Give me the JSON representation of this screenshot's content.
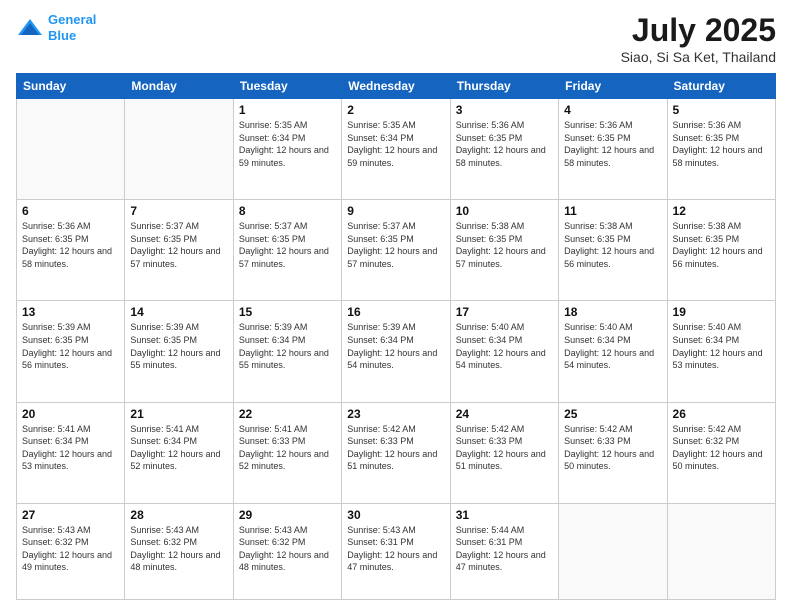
{
  "logo": {
    "line1": "General",
    "line2": "Blue"
  },
  "title": "July 2025",
  "subtitle": "Siao, Si Sa Ket, Thailand",
  "weekdays": [
    "Sunday",
    "Monday",
    "Tuesday",
    "Wednesday",
    "Thursday",
    "Friday",
    "Saturday"
  ],
  "weeks": [
    [
      {
        "day": "",
        "sunrise": "",
        "sunset": "",
        "daylight": ""
      },
      {
        "day": "",
        "sunrise": "",
        "sunset": "",
        "daylight": ""
      },
      {
        "day": "1",
        "sunrise": "Sunrise: 5:35 AM",
        "sunset": "Sunset: 6:34 PM",
        "daylight": "Daylight: 12 hours and 59 minutes."
      },
      {
        "day": "2",
        "sunrise": "Sunrise: 5:35 AM",
        "sunset": "Sunset: 6:34 PM",
        "daylight": "Daylight: 12 hours and 59 minutes."
      },
      {
        "day": "3",
        "sunrise": "Sunrise: 5:36 AM",
        "sunset": "Sunset: 6:35 PM",
        "daylight": "Daylight: 12 hours and 58 minutes."
      },
      {
        "day": "4",
        "sunrise": "Sunrise: 5:36 AM",
        "sunset": "Sunset: 6:35 PM",
        "daylight": "Daylight: 12 hours and 58 minutes."
      },
      {
        "day": "5",
        "sunrise": "Sunrise: 5:36 AM",
        "sunset": "Sunset: 6:35 PM",
        "daylight": "Daylight: 12 hours and 58 minutes."
      }
    ],
    [
      {
        "day": "6",
        "sunrise": "Sunrise: 5:36 AM",
        "sunset": "Sunset: 6:35 PM",
        "daylight": "Daylight: 12 hours and 58 minutes."
      },
      {
        "day": "7",
        "sunrise": "Sunrise: 5:37 AM",
        "sunset": "Sunset: 6:35 PM",
        "daylight": "Daylight: 12 hours and 57 minutes."
      },
      {
        "day": "8",
        "sunrise": "Sunrise: 5:37 AM",
        "sunset": "Sunset: 6:35 PM",
        "daylight": "Daylight: 12 hours and 57 minutes."
      },
      {
        "day": "9",
        "sunrise": "Sunrise: 5:37 AM",
        "sunset": "Sunset: 6:35 PM",
        "daylight": "Daylight: 12 hours and 57 minutes."
      },
      {
        "day": "10",
        "sunrise": "Sunrise: 5:38 AM",
        "sunset": "Sunset: 6:35 PM",
        "daylight": "Daylight: 12 hours and 57 minutes."
      },
      {
        "day": "11",
        "sunrise": "Sunrise: 5:38 AM",
        "sunset": "Sunset: 6:35 PM",
        "daylight": "Daylight: 12 hours and 56 minutes."
      },
      {
        "day": "12",
        "sunrise": "Sunrise: 5:38 AM",
        "sunset": "Sunset: 6:35 PM",
        "daylight": "Daylight: 12 hours and 56 minutes."
      }
    ],
    [
      {
        "day": "13",
        "sunrise": "Sunrise: 5:39 AM",
        "sunset": "Sunset: 6:35 PM",
        "daylight": "Daylight: 12 hours and 56 minutes."
      },
      {
        "day": "14",
        "sunrise": "Sunrise: 5:39 AM",
        "sunset": "Sunset: 6:35 PM",
        "daylight": "Daylight: 12 hours and 55 minutes."
      },
      {
        "day": "15",
        "sunrise": "Sunrise: 5:39 AM",
        "sunset": "Sunset: 6:34 PM",
        "daylight": "Daylight: 12 hours and 55 minutes."
      },
      {
        "day": "16",
        "sunrise": "Sunrise: 5:39 AM",
        "sunset": "Sunset: 6:34 PM",
        "daylight": "Daylight: 12 hours and 54 minutes."
      },
      {
        "day": "17",
        "sunrise": "Sunrise: 5:40 AM",
        "sunset": "Sunset: 6:34 PM",
        "daylight": "Daylight: 12 hours and 54 minutes."
      },
      {
        "day": "18",
        "sunrise": "Sunrise: 5:40 AM",
        "sunset": "Sunset: 6:34 PM",
        "daylight": "Daylight: 12 hours and 54 minutes."
      },
      {
        "day": "19",
        "sunrise": "Sunrise: 5:40 AM",
        "sunset": "Sunset: 6:34 PM",
        "daylight": "Daylight: 12 hours and 53 minutes."
      }
    ],
    [
      {
        "day": "20",
        "sunrise": "Sunrise: 5:41 AM",
        "sunset": "Sunset: 6:34 PM",
        "daylight": "Daylight: 12 hours and 53 minutes."
      },
      {
        "day": "21",
        "sunrise": "Sunrise: 5:41 AM",
        "sunset": "Sunset: 6:34 PM",
        "daylight": "Daylight: 12 hours and 52 minutes."
      },
      {
        "day": "22",
        "sunrise": "Sunrise: 5:41 AM",
        "sunset": "Sunset: 6:33 PM",
        "daylight": "Daylight: 12 hours and 52 minutes."
      },
      {
        "day": "23",
        "sunrise": "Sunrise: 5:42 AM",
        "sunset": "Sunset: 6:33 PM",
        "daylight": "Daylight: 12 hours and 51 minutes."
      },
      {
        "day": "24",
        "sunrise": "Sunrise: 5:42 AM",
        "sunset": "Sunset: 6:33 PM",
        "daylight": "Daylight: 12 hours and 51 minutes."
      },
      {
        "day": "25",
        "sunrise": "Sunrise: 5:42 AM",
        "sunset": "Sunset: 6:33 PM",
        "daylight": "Daylight: 12 hours and 50 minutes."
      },
      {
        "day": "26",
        "sunrise": "Sunrise: 5:42 AM",
        "sunset": "Sunset: 6:32 PM",
        "daylight": "Daylight: 12 hours and 50 minutes."
      }
    ],
    [
      {
        "day": "27",
        "sunrise": "Sunrise: 5:43 AM",
        "sunset": "Sunset: 6:32 PM",
        "daylight": "Daylight: 12 hours and 49 minutes."
      },
      {
        "day": "28",
        "sunrise": "Sunrise: 5:43 AM",
        "sunset": "Sunset: 6:32 PM",
        "daylight": "Daylight: 12 hours and 48 minutes."
      },
      {
        "day": "29",
        "sunrise": "Sunrise: 5:43 AM",
        "sunset": "Sunset: 6:32 PM",
        "daylight": "Daylight: 12 hours and 48 minutes."
      },
      {
        "day": "30",
        "sunrise": "Sunrise: 5:43 AM",
        "sunset": "Sunset: 6:31 PM",
        "daylight": "Daylight: 12 hours and 47 minutes."
      },
      {
        "day": "31",
        "sunrise": "Sunrise: 5:44 AM",
        "sunset": "Sunset: 6:31 PM",
        "daylight": "Daylight: 12 hours and 47 minutes."
      },
      {
        "day": "",
        "sunrise": "",
        "sunset": "",
        "daylight": ""
      },
      {
        "day": "",
        "sunrise": "",
        "sunset": "",
        "daylight": ""
      }
    ]
  ]
}
